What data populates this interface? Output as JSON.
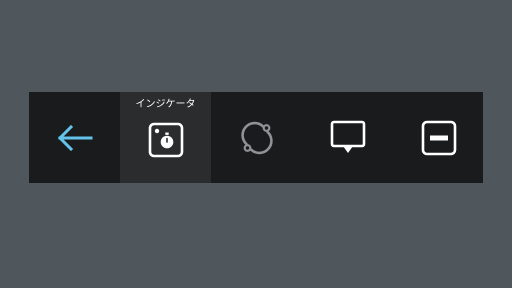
{
  "toolbar": {
    "buttons": [
      {
        "id": "back",
        "icon": "arrow-left-icon",
        "color": "#63c3ea"
      },
      {
        "id": "indicator",
        "label": "インジケータ",
        "icon": "stopwatch-icon",
        "active": true
      },
      {
        "id": "sync",
        "icon": "sync-icon",
        "color": "#8f9294"
      },
      {
        "id": "display",
        "icon": "monitor-icon"
      },
      {
        "id": "minimize",
        "icon": "minimize-icon"
      }
    ]
  },
  "colors": {
    "background": "#4f575d",
    "toolbar": "#191b1c",
    "active_button": "#2a2c2e",
    "accent": "#63c3ea",
    "icon": "#ffffff",
    "muted_icon": "#8f9294"
  }
}
